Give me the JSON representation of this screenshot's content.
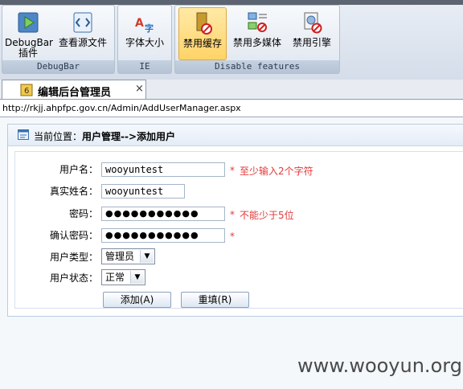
{
  "toolbar": {
    "groups": [
      {
        "label": "DebugBar",
        "buttons": [
          {
            "label": "DebugBar 插件"
          },
          {
            "label": "查看源文件"
          }
        ]
      },
      {
        "label": "IE",
        "buttons": [
          {
            "label": "字体大小"
          }
        ]
      },
      {
        "label": "Disable features",
        "buttons": [
          {
            "label": "禁用缓存"
          },
          {
            "label": "禁用多媒体"
          },
          {
            "label": "禁用引擎"
          }
        ]
      }
    ]
  },
  "tab": {
    "title": "编辑后台管理员",
    "close": "×",
    "badge": "6"
  },
  "address": {
    "url": "http://rkjj.ahpfpc.gov.cn/Admin/AddUserManager.aspx"
  },
  "panel": {
    "crumb_prefix": "当前位置：",
    "crumb_path": "用户管理-->添加用户"
  },
  "form": {
    "username": {
      "label": "用户名：",
      "value": "wooyuntest",
      "required": "*",
      "hint": "至少输入2个字符"
    },
    "realname": {
      "label": "真实姓名：",
      "value": "wooyuntest"
    },
    "password": {
      "label": "密码：",
      "value": "●●●●●●●●●●●",
      "required": "*",
      "hint": "不能少于5位"
    },
    "confirm": {
      "label": "确认密码：",
      "value": "●●●●●●●●●●●",
      "required": "*"
    },
    "usertype": {
      "label": "用户类型：",
      "selected": "管理员"
    },
    "userstatus": {
      "label": "用户状态：",
      "selected": "正常"
    },
    "add_button": "添加(A)",
    "reset_button": "重填(R)"
  },
  "watermark": "www.wooyun.org",
  "colors": {
    "required": "#e23a3a",
    "panel_border": "#b9cbe0",
    "toolbar_active": "#ffd366"
  }
}
